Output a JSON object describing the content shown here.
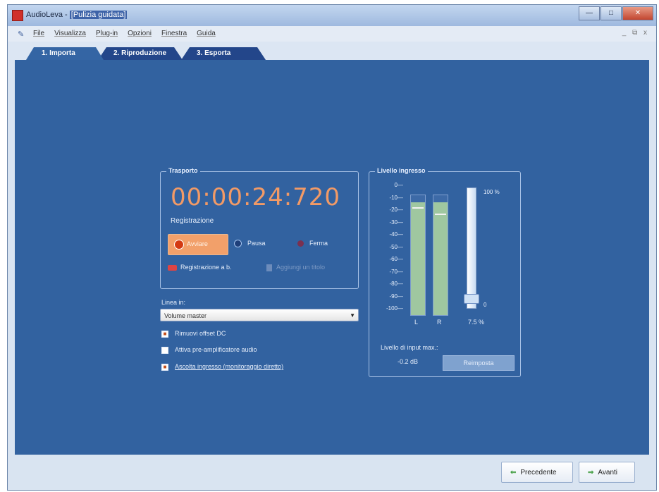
{
  "window": {
    "app_name": "AudioLeva - ",
    "doc_name": "[Pulizia guidata]",
    "controls": [
      "—",
      "□",
      "✕"
    ]
  },
  "menu": {
    "items": [
      "File",
      "Visualizza",
      "Plug-in",
      "Opzioni",
      "Finestra",
      "Guida"
    ],
    "right": "_ ⧉ x"
  },
  "tabs": [
    "1. Importa",
    "2. Riproduzione",
    "3. Esporta"
  ],
  "transport": {
    "title": "Trasporto",
    "time": "00:00:24:720",
    "status": "Registrazione",
    "record_label": "Avviare",
    "pause_label": "Pausa",
    "stop_label": "Ferma",
    "timed_rec_label": "Registrazione a b.",
    "disabled_label": "Aggiungi un titolo"
  },
  "source": {
    "label": "Linea in:",
    "selected": "Volume master",
    "options": [
      {
        "label": "Rimuovi offset DC",
        "checked": true
      },
      {
        "label": "Attiva pre-amplificatore audio",
        "checked": false
      },
      {
        "label": "Ascolta ingresso (monitoraggio diretto)",
        "checked": true
      }
    ]
  },
  "level": {
    "title": "Livello ingresso",
    "scale": [
      "0",
      "-10",
      "-20",
      "-30",
      "-40",
      "-50",
      "-60",
      "-70",
      "-80",
      "-90",
      "-100"
    ],
    "channels": [
      {
        "label": "L",
        "level": 0.94,
        "peak": 0.9
      },
      {
        "label": "R",
        "level": 0.94,
        "peak": 0.85
      }
    ],
    "slider_max": "100 %",
    "slider_min": "0",
    "slider_value_text": "7.5 %",
    "slider_value": 0.075,
    "max_input_label": "Livello di input max.:",
    "max_input_value": "-0.2 dB",
    "reset_label": "Reimposta"
  },
  "footer": {
    "prev_label": "Precedente",
    "next_label": "Avanti"
  }
}
